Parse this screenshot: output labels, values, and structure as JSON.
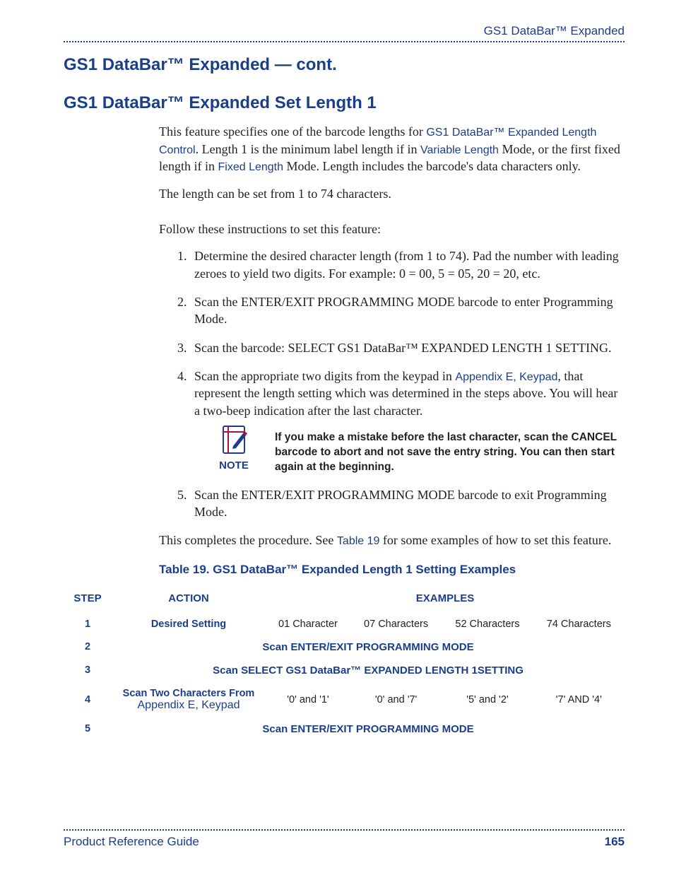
{
  "header": {
    "running_head": "GS1 DataBar™ Expanded"
  },
  "titles": {
    "section": "GS1 DataBar™ Expanded — cont.",
    "subsection": "GS1 DataBar™ Expanded Set Length 1"
  },
  "intro": {
    "p1_a": "This feature specifies one of the barcode lengths for ",
    "p1_link1": "GS1 DataBar™ Expanded Length Control",
    "p1_b": ". Length 1 is the minimum label length if in ",
    "p1_link2": "Variable Length",
    "p1_c": " Mode, or the first fixed length if in ",
    "p1_link3": "Fixed Length",
    "p1_d": " Mode. Length includes the barcode's data characters only.",
    "p2": "The length can be set from 1 to 74 characters.",
    "p3": "Follow these instructions to set this feature:"
  },
  "steps": {
    "s1": "Determine the desired character length (from 1 to 74). Pad the number with leading zeroes to yield two digits. For example: 0 = 00, 5 = 05, 20 = 20, etc.",
    "s2": "Scan the ENTER/EXIT PROGRAMMING MODE barcode to enter Programming Mode.",
    "s3": "Scan the barcode: SELECT GS1 DataBar™ EXPANDED LENGTH 1 SETTING.",
    "s4_a": "Scan the appropriate two digits from the keypad in ",
    "s4_link": "Appendix E, Keypad",
    "s4_b": ", that represent the length setting which was determined in the steps above. You will hear a two-beep indication after the last character.",
    "s5": "Scan the ENTER/EXIT PROGRAMMING MODE barcode to exit Programming Mode."
  },
  "note": {
    "label": "NOTE",
    "text": "If you make a mistake before the last character, scan the CANCEL barcode to abort and not save the entry string. You can then start again at the beginning."
  },
  "closing": {
    "a": "This completes the procedure. See ",
    "link": "Table 19",
    "b": " for some examples of how to set this feature."
  },
  "table": {
    "caption": "Table 19. GS1 DataBar™ Expanded Length 1 Setting Examples",
    "head": {
      "step": "STEP",
      "action": "ACTION",
      "examples": "EXAMPLES"
    },
    "rows": [
      {
        "step": "1",
        "action": "Desired Setting",
        "cells": [
          "01 Character",
          "07 Characters",
          "52 Characters",
          "74 Characters"
        ]
      },
      {
        "step": "2",
        "span": "Scan ENTER/EXIT PROGRAMMING MODE"
      },
      {
        "step": "3",
        "span": "Scan SELECT GS1 DataBar™ EXPANDED LENGTH 1SETTING"
      },
      {
        "step": "4",
        "action_a": "Scan Two Characters From ",
        "action_link": "Appendix E, Keypad",
        "cells": [
          "'0' and '1'",
          "'0' and '7'",
          "'5' and '2'",
          "'7' AND '4'"
        ]
      },
      {
        "step": "5",
        "span": "Scan ENTER/EXIT PROGRAMMING MODE"
      }
    ]
  },
  "footer": {
    "left": "Product Reference Guide",
    "page": "165"
  }
}
